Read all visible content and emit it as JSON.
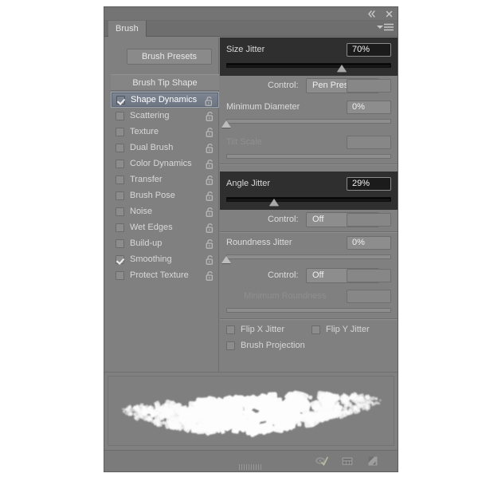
{
  "window": {
    "title": "Brush",
    "collapse_icon": "double-left-arrow-icon",
    "close_icon": "close-icon",
    "menu_icon": "panel-menu-icon"
  },
  "sidebar": {
    "presets_button": "Brush Presets",
    "tip_shape_label": "Brush Tip Shape",
    "items": [
      {
        "label": "Shape Dynamics",
        "checked": true,
        "selected": true
      },
      {
        "label": "Scattering",
        "checked": false,
        "selected": false
      },
      {
        "label": "Texture",
        "checked": false,
        "selected": false
      },
      {
        "label": "Dual Brush",
        "checked": false,
        "selected": false
      },
      {
        "label": "Color Dynamics",
        "checked": false,
        "selected": false
      },
      {
        "label": "Transfer",
        "checked": false,
        "selected": false
      },
      {
        "label": "Brush Pose",
        "checked": false,
        "selected": false
      },
      {
        "label": "Noise",
        "checked": false,
        "selected": false
      },
      {
        "label": "Wet Edges",
        "checked": false,
        "selected": false
      },
      {
        "label": "Build-up",
        "checked": false,
        "selected": false
      },
      {
        "label": "Smoothing",
        "checked": true,
        "selected": false
      },
      {
        "label": "Protect Texture",
        "checked": false,
        "selected": false
      }
    ],
    "lock_icon": "unlocked-padlock-icon"
  },
  "settings": {
    "size_jitter": {
      "label": "Size Jitter",
      "value": "70%",
      "percent": 70,
      "highlighted": true
    },
    "size_control": {
      "label": "Control:",
      "value": "Pen Pressure",
      "disabled": false
    },
    "minimum_diameter": {
      "label": "Minimum Diameter",
      "value": "0%",
      "percent": 0
    },
    "tilt_scale": {
      "label": "Tilt Scale",
      "value": "",
      "percent": 0,
      "disabled": true
    },
    "angle_jitter": {
      "label": "Angle Jitter",
      "value": "29%",
      "percent": 29,
      "highlighted": true
    },
    "angle_control": {
      "label": "Control:",
      "value": "Off",
      "disabled": false
    },
    "roundness_jitter": {
      "label": "Roundness Jitter",
      "value": "0%",
      "percent": 0
    },
    "roundness_control": {
      "label": "Control:",
      "value": "Off",
      "disabled": false
    },
    "minimum_roundness": {
      "label": "Minimum Roundness",
      "value": "",
      "percent": 0,
      "disabled": true
    },
    "flip_x_jitter": {
      "label": "Flip X Jitter",
      "checked": false
    },
    "flip_y_jitter": {
      "label": "Flip Y Jitter",
      "checked": false
    },
    "brush_projection": {
      "label": "Brush Projection",
      "checked": false
    }
  },
  "footer": {
    "icons": [
      "toggle-brush-options-icon",
      "create-new-preset-icon",
      "new-brush-icon"
    ],
    "resize_grip": "resize-grip-icon"
  },
  "colors": {
    "panel_bg": "#808080",
    "highlight_bg": "#2f2f2f",
    "selected_row": "#7d8592",
    "text": "#dcdcdc",
    "text_disabled": "#8f8f8f",
    "control_bg": "#8d8d8d"
  }
}
